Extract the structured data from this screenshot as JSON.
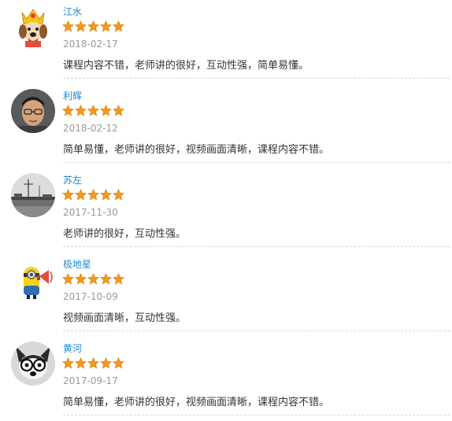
{
  "reviews": [
    {
      "username": "江水",
      "date": "2018-02-17",
      "rating": 5,
      "comment": "课程内容不错，老师讲的很好，互动性强，简单易懂。",
      "avatar": "cartoon-king-avatar"
    },
    {
      "username": "利辉",
      "date": "2018-02-12",
      "rating": 5,
      "comment": "简单易懂，老师讲的很好，视频画面清晰，课程内容不错。",
      "avatar": "man-with-glasses-avatar"
    },
    {
      "username": "苏左",
      "date": "2017-11-30",
      "rating": 5,
      "comment": "老师讲的很好，互动性强。",
      "avatar": "landscape-photo-avatar"
    },
    {
      "username": "极地星",
      "date": "2017-10-09",
      "rating": 5,
      "comment": "视频画面清晰，互动性强。",
      "avatar": "minion-megaphone-avatar"
    },
    {
      "username": "黄河",
      "date": "2017-09-17",
      "rating": 5,
      "comment": "简单易懂，老师讲的很好，视频画面清晰，课程内容不错。",
      "avatar": "dog-with-glasses-avatar"
    }
  ],
  "colors": {
    "username": "#1f8ad6",
    "date": "#999999",
    "comment": "#333333",
    "star": "#f39a1c",
    "divider": "#d9d9d9"
  },
  "icons": {
    "star": "star-icon"
  }
}
